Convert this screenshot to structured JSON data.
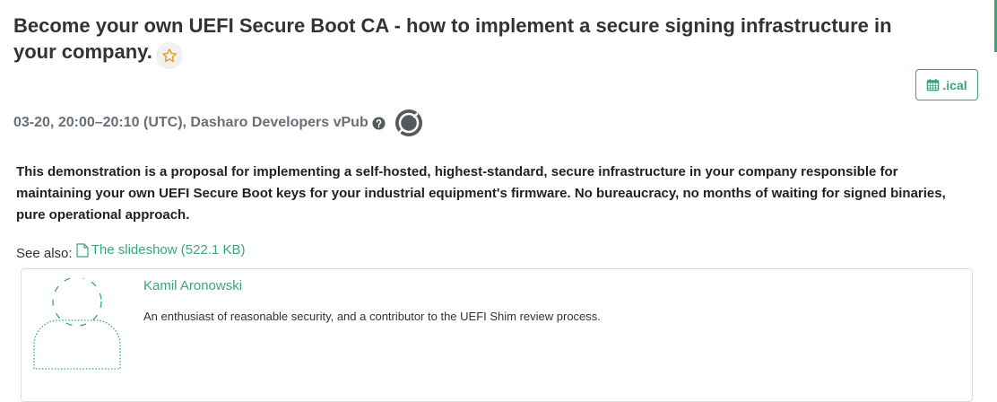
{
  "talk": {
    "title": "Become your own UEFI Secure Boot CA - how to implement a secure signing infrastructure in your company.",
    "ical_label": ".ical",
    "schedule": "03-20, 20:00–20:10 (UTC), Dasharo Developers vPub",
    "abstract": "This demonstration is a proposal for implementing a self-hosted, highest-standard, secure infrastructure in your company responsible for maintaining your own UEFI Secure Boot keys for your industrial equipment's firmware. No bureaucracy, no months of waiting for signed binaries, pure operational approach.",
    "see_also_label": "See also:",
    "slideshow_link": "The slideshow (522.1 KB)"
  },
  "speaker": {
    "name": "Kamil Aronowski",
    "bio": "An enthusiast of reasonable security, and a contributor to the UEFI Shim review process."
  },
  "icons": {
    "favourite": "star-outline-icon",
    "calendar": "calendar-icon",
    "help": "question-circle-icon",
    "vpub": "video-chat-icon",
    "file": "file-icon",
    "avatar": "default-avatar-icon"
  },
  "colors": {
    "accent": "#3aa57a",
    "star": "#f0a020",
    "heading": "#333333",
    "muted": "#686f76"
  }
}
